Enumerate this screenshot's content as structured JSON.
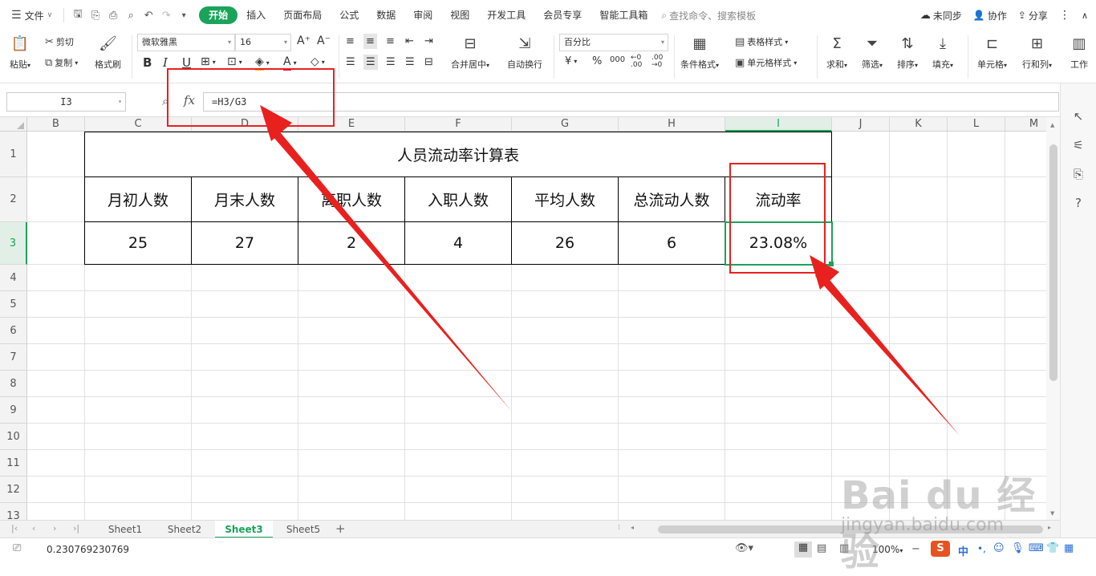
{
  "menubar": {
    "file_label": "文件",
    "tabs": [
      "开始",
      "插入",
      "页面布局",
      "公式",
      "数据",
      "审阅",
      "视图",
      "开发工具",
      "会员专享",
      "智能工具箱"
    ],
    "active_tab": "开始",
    "search_placeholder": "查找命令、搜索模板",
    "sync_label": "未同步",
    "collab_label": "协作",
    "share_label": "分享"
  },
  "ribbon": {
    "paste": "粘贴",
    "cut": "剪切",
    "copy": "复制",
    "format_painter": "格式刷",
    "font_name": "微软雅黑",
    "font_size": "16",
    "merge_center": "合并居中",
    "wrap_text": "自动换行",
    "number_format": "百分比",
    "conditional_format": "条件格式",
    "table_style": "表格样式",
    "cell_style": "单元格样式",
    "sum": "求和",
    "filter": "筛选",
    "sort": "排序",
    "fill": "填充",
    "cell": "单元格",
    "rows_cols": "行和列",
    "worksheet": "工作"
  },
  "formula_bar": {
    "name_box": "I3",
    "fx": "fx",
    "formula": "=H3/G3"
  },
  "columns": [
    "B",
    "C",
    "D",
    "E",
    "F",
    "G",
    "H",
    "I",
    "J",
    "K",
    "L",
    "M"
  ],
  "selected_column": "I",
  "rows": [
    "1",
    "2",
    "3",
    "4",
    "5",
    "6",
    "7",
    "8",
    "9",
    "10",
    "11",
    "12",
    "13"
  ],
  "selected_row": "3",
  "table": {
    "title": "人员流动率计算表",
    "headers": [
      "月初人数",
      "月末人数",
      "离职人数",
      "入职人数",
      "平均人数",
      "总流动人数",
      "流动率"
    ],
    "values": [
      "25",
      "27",
      "2",
      "4",
      "26",
      "6",
      "23.08%"
    ]
  },
  "sheets": [
    "Sheet1",
    "Sheet2",
    "Sheet3",
    "Sheet5"
  ],
  "active_sheet": "Sheet3",
  "status": {
    "value": "0.230769230769",
    "zoom": "100%"
  },
  "watermark": {
    "brand": "Bai du 经验",
    "url": "jingyan.baidu.com"
  },
  "colors": {
    "accent": "#1aa35b",
    "annotation": "#e8211f"
  }
}
